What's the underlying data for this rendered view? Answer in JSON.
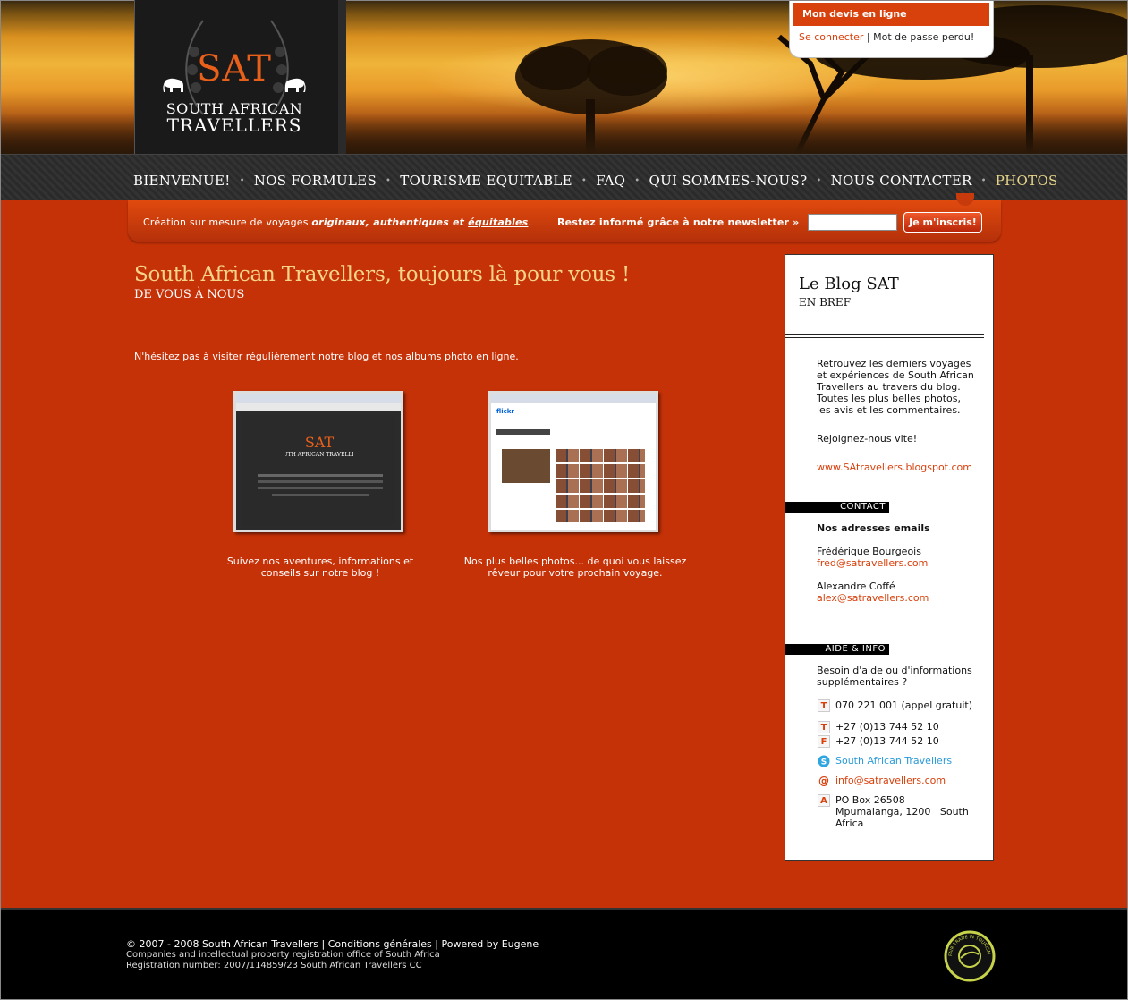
{
  "devis": {
    "title": "Mon devis en ligne",
    "login": "Se connecter",
    "separator": "|",
    "forgot": "Mot de passe perdu!"
  },
  "logo": {
    "abbr": "SAT",
    "line1": "SOUTH AFRICAN",
    "line2": "TRAVELLERS"
  },
  "nav": {
    "items": [
      "BIENVENUE!",
      "NOS FORMULES",
      "TOURISME EQUITABLE",
      "FAQ",
      "QUI SOMMES-NOUS?",
      "NOUS CONTACTER",
      "PHOTOS"
    ],
    "active": "PHOTOS",
    "separator": "•"
  },
  "bar": {
    "tag_prefix": "Création sur mesure de voyages ",
    "tag_bold": "originaux, authentiques et ",
    "tag_underline": "équitables",
    "tag_suffix": ".",
    "newsletter": "Restez informé grâce à notre newsletter »",
    "subscribe": "Je m'inscris!"
  },
  "main": {
    "title": "South African Travellers, toujours là pour vous !",
    "subtitle": "DE VOUS À NOUS",
    "intro": "N'hésitez pas à visiter régulièrement notre blog et nos albums photo en ligne.",
    "cards": [
      {
        "caption1": "Suivez nos aventures, informations et",
        "caption2": "conseils sur notre blog !"
      },
      {
        "caption1": "Nos plus belles photos... de quoi vous laissez",
        "caption2": "rêveur pour votre prochain voyage."
      }
    ]
  },
  "sidebar": {
    "title": "Le Blog SAT",
    "subtitle": "EN BREF",
    "blog_text": [
      "Retrouvez les derniers voyages",
      "et expériences de South African",
      "Travellers au travers du blog.",
      "Toutes les plus belles photos,",
      "les avis et les commentaires."
    ],
    "join": "Rejoignez-nous vite!",
    "blog_link": "www.SAtravellers.blogspot.com",
    "contact_head": "CONTACT",
    "emails_title": "Nos adresses emails",
    "person1": "Frédérique Bourgeois",
    "email1": "fred@satravellers.com",
    "person2": "Alexandre Coffé",
    "email2": "alex@satravellers.com",
    "help_head": "AIDE & INFO",
    "help_text1": "Besoin d'aide ou d'informations",
    "help_text2": "supplémentaires ?",
    "phone_free": "070 221 001 (appel gratuit)",
    "phone": "+27 (0)13 744 52 10",
    "fax": "+27 (0)13 744 52 10",
    "skype": "South African Travellers",
    "email": "info@satravellers.com",
    "address1": "PO Box 26508",
    "address2": "Mpumalanga, 1200   South",
    "address3": "Africa",
    "icons": {
      "t": "T",
      "f": "F",
      "at": "@",
      "a": "A"
    }
  },
  "footer": {
    "line1": "© 2007 - 2008 South African Travellers | Conditions générales | Powered by Eugene",
    "line2": "Companies and intellectual property registration office of South Africa",
    "line3": "Registration number: 2007/114859/23 South African Travellers CC",
    "badge": "FAIR TRADE IN TOURISM SOUTH AFRICA"
  }
}
